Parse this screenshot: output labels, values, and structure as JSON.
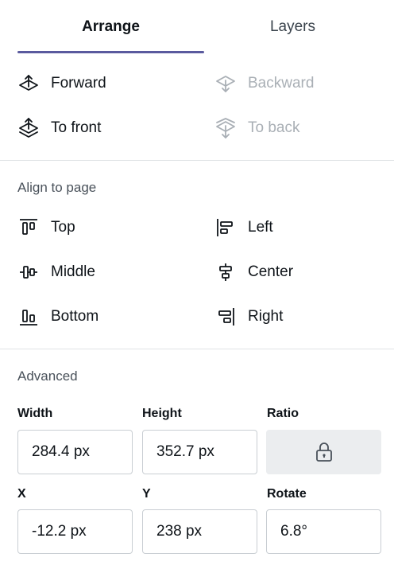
{
  "tabs": [
    {
      "label": "Arrange",
      "active": true
    },
    {
      "label": "Layers",
      "active": false
    }
  ],
  "arrange": {
    "forward": {
      "label": "Forward",
      "icon": "forward-icon",
      "enabled": true
    },
    "backward": {
      "label": "Backward",
      "icon": "backward-icon",
      "enabled": false
    },
    "to_front": {
      "label": "To front",
      "icon": "to-front-icon",
      "enabled": true
    },
    "to_back": {
      "label": "To back",
      "icon": "to-back-icon",
      "enabled": false
    }
  },
  "align": {
    "title": "Align to page",
    "top": {
      "label": "Top",
      "icon": "align-top-icon"
    },
    "left": {
      "label": "Left",
      "icon": "align-left-icon"
    },
    "middle": {
      "label": "Middle",
      "icon": "align-middle-icon"
    },
    "center": {
      "label": "Center",
      "icon": "align-center-icon"
    },
    "bottom": {
      "label": "Bottom",
      "icon": "align-bottom-icon"
    },
    "right": {
      "label": "Right",
      "icon": "align-right-icon"
    }
  },
  "advanced": {
    "title": "Advanced",
    "width": {
      "label": "Width",
      "value": "284.4 px"
    },
    "height": {
      "label": "Height",
      "value": "352.7 px"
    },
    "ratio": {
      "label": "Ratio",
      "icon": "lock-icon"
    },
    "x": {
      "label": "X",
      "value": "-12.2 px"
    },
    "y": {
      "label": "Y",
      "value": "238 px"
    },
    "rotate": {
      "label": "Rotate",
      "value": "6.8°"
    }
  },
  "colors": {
    "accent": "#5a5a9e",
    "text": "#0e1318",
    "disabled": "#a9afb5",
    "divider": "#dfe2e5",
    "lock_bg": "#ebedef"
  }
}
